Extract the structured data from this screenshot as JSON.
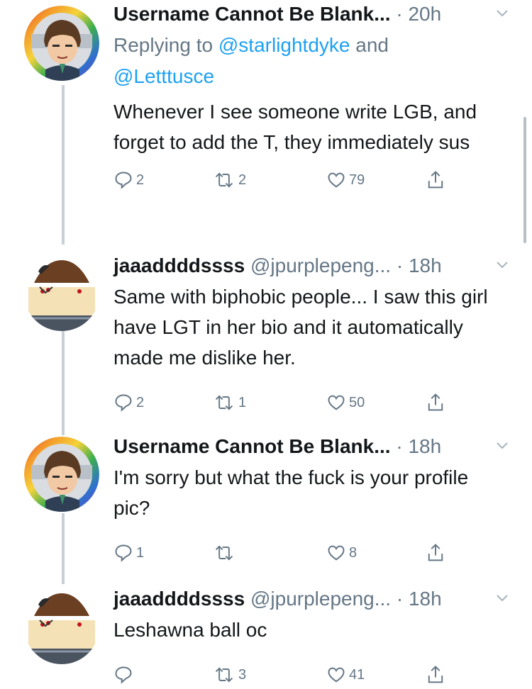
{
  "tweets": [
    {
      "display_name": "Username Cannot Be Blank...",
      "handle": "",
      "time": "· 20h",
      "reply_prefix": "Replying to ",
      "reply_mention_1": "@starlightdyke",
      "reply_and": " and",
      "reply_mention_2": "@Letttusce",
      "text": "Whenever I see someone write LGB, and forget to add the T, they immediately sus",
      "replies": "2",
      "retweets": "2",
      "likes": "79",
      "avatar": "anime-character-rainbow-ring"
    },
    {
      "display_name": "jaaaddddssss",
      "handle": "@jpurplepeng...",
      "time": "· 18h",
      "text": "Same with biphobic people... I saw this girl have LGT in her bio and it automatically made me dislike her.",
      "replies": "2",
      "retweets": "1",
      "likes": "50",
      "avatar": "ball-character"
    },
    {
      "display_name": "Username Cannot Be Blank...",
      "handle": "",
      "time": "· 18h",
      "text": "I'm sorry but what the fuck is your profile pic?",
      "replies": "1",
      "retweets": "",
      "likes": "8",
      "avatar": "anime-character-rainbow-ring"
    },
    {
      "display_name": "jaaaddddssss",
      "handle": "@jpurplepeng...",
      "time": "· 18h",
      "text": "Leshawna ball oc",
      "replies": "",
      "retweets": "3",
      "likes": "41",
      "avatar": "ball-character"
    }
  ],
  "colors": {
    "text": "#14171a",
    "secondary": "#657786",
    "link": "#1da1f2",
    "thread_line": "#c8d0d6"
  }
}
